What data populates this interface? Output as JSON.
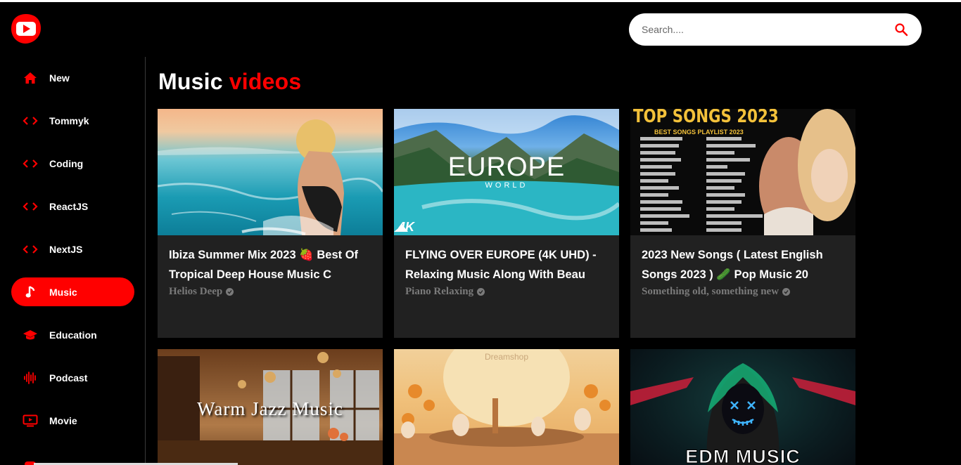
{
  "search": {
    "placeholder": "Search...."
  },
  "sidebar": {
    "items": [
      {
        "label": "New",
        "icon": "home-icon"
      },
      {
        "label": "Tommyk",
        "icon": "code-icon"
      },
      {
        "label": "Coding",
        "icon": "code-icon"
      },
      {
        "label": "ReactJS",
        "icon": "code-icon"
      },
      {
        "label": "NextJS",
        "icon": "code-icon"
      },
      {
        "label": "Music",
        "icon": "music-note-icon",
        "active": true
      },
      {
        "label": "Education",
        "icon": "graduation-cap-icon"
      },
      {
        "label": "Podcast",
        "icon": "waveform-icon"
      },
      {
        "label": "Movie",
        "icon": "tv-icon"
      }
    ]
  },
  "main": {
    "title_part1": "Music",
    "title_part2": "videos",
    "videos": [
      {
        "title_line1": "Ibiza Summer Mix 2023 🍓 Best Of",
        "title_line2": "Tropical Deep House Music C",
        "channel": "Helios Deep"
      },
      {
        "title_line1": "FLYING OVER EUROPE (4K UHD) -",
        "title_line2": "Relaxing Music Along With Beau",
        "channel": "Piano Relaxing",
        "thumb_text": "EUROPE",
        "thumb_sub": "WORLD",
        "thumb_badge": "4K"
      },
      {
        "title_line1": "2023 New Songs ( Latest English",
        "title_line2": "Songs 2023 ) 🥒 Pop Music 20",
        "channel": "Something old, something new",
        "thumb_text": "TOP SONGS 2023",
        "thumb_sub": "BEST SONGS PLAYLIST 2023"
      },
      {
        "thumb_text": "Warm Jazz Music"
      },
      {
        "thumb_text": "Dreamshop"
      },
      {
        "thumb_text": "EDM MUSIC"
      }
    ]
  },
  "colors": {
    "accent": "#ff0000",
    "card_bg": "#212121",
    "channel_text": "#7a7a7a"
  }
}
